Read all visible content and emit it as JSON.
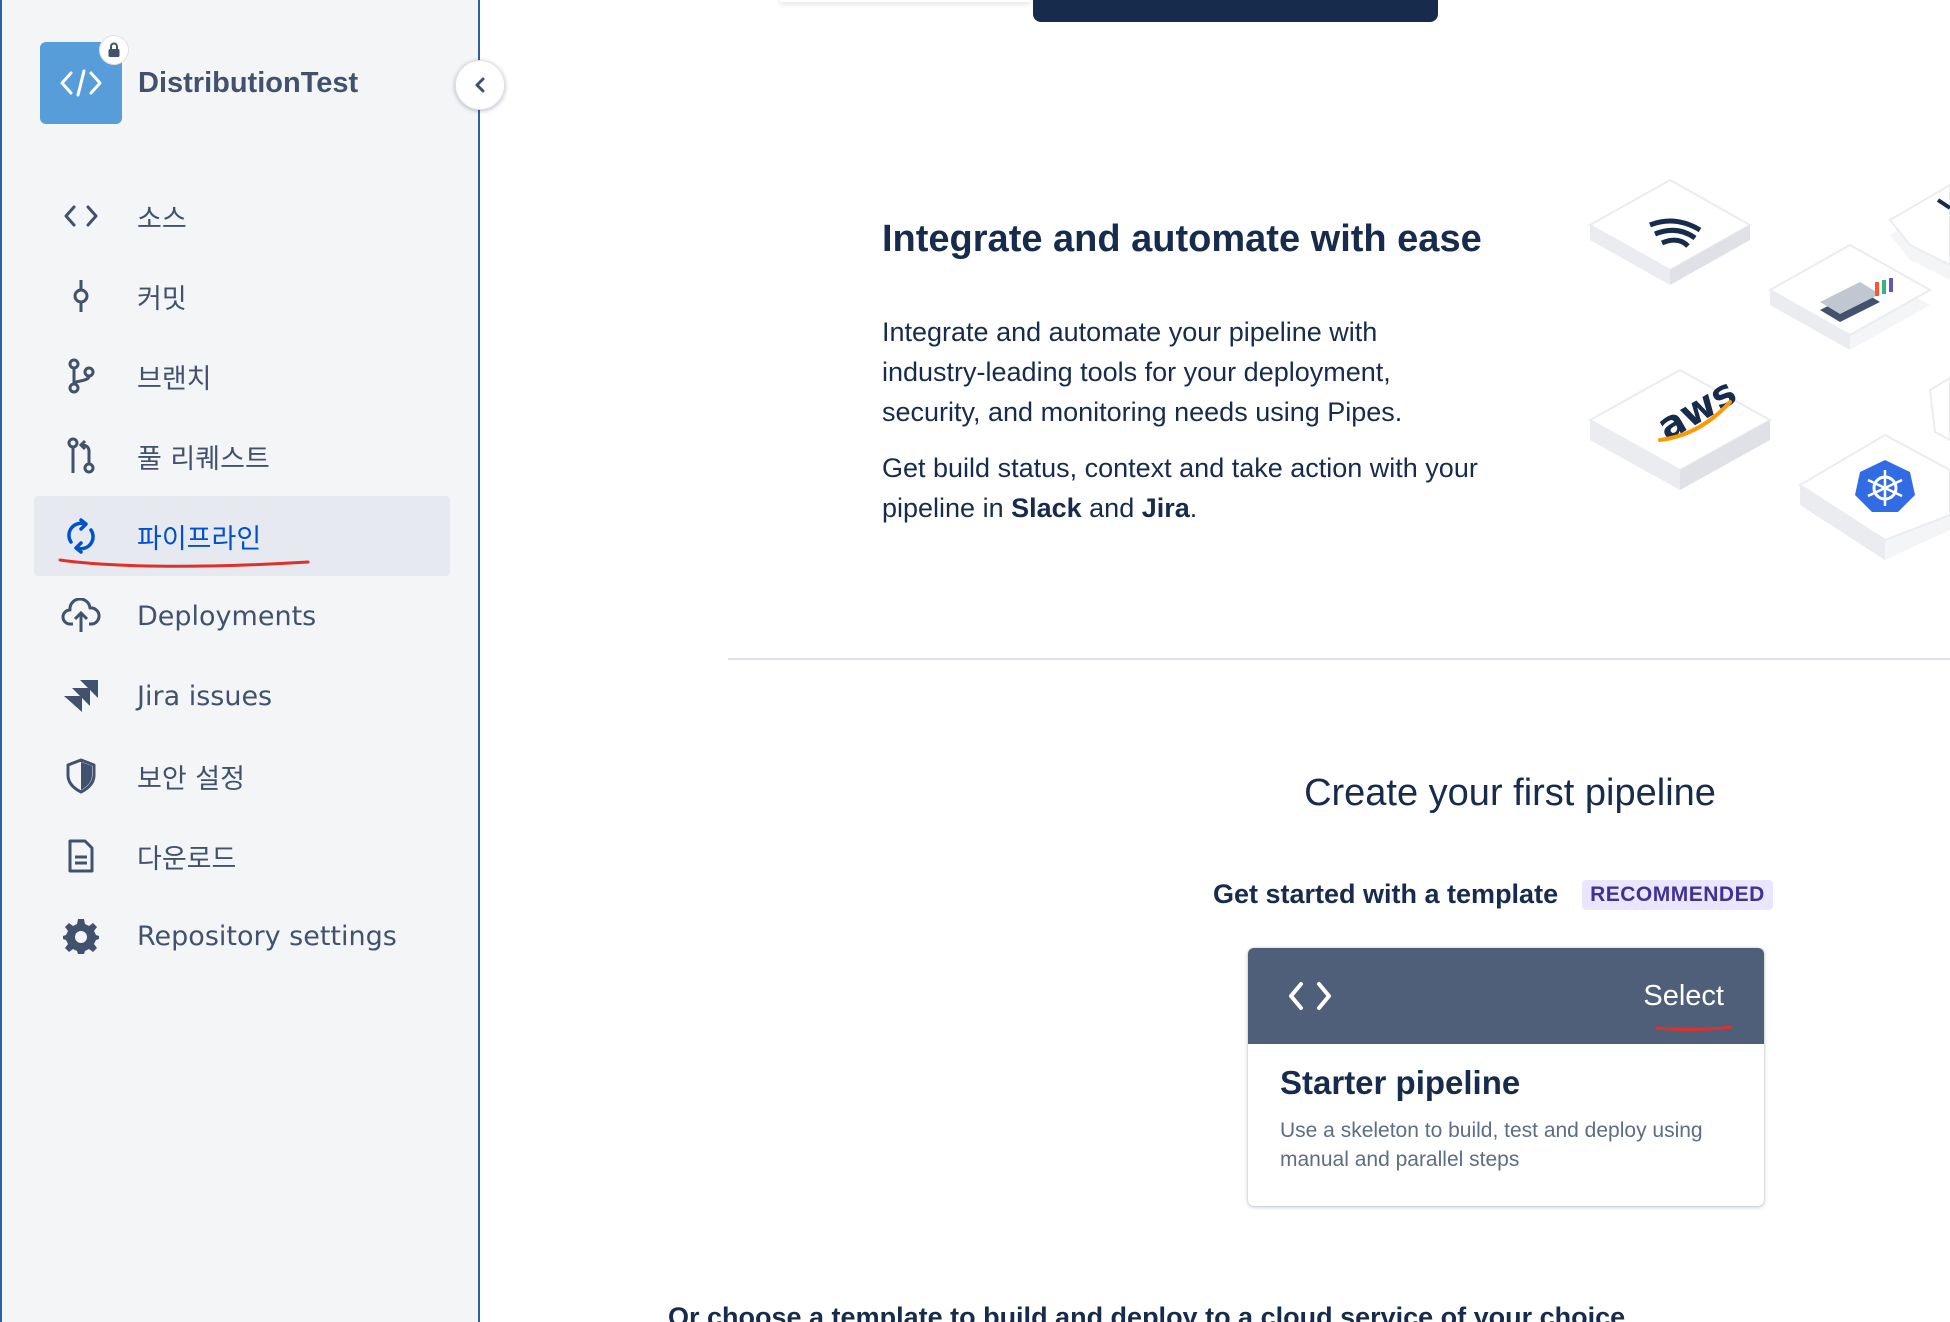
{
  "repo": {
    "name": "DistributionTest"
  },
  "nav": {
    "items": [
      {
        "label": "소스",
        "icon": "code-icon"
      },
      {
        "label": "커밋",
        "icon": "commit-icon"
      },
      {
        "label": "브랜치",
        "icon": "branch-icon"
      },
      {
        "label": "풀 리퀘스트",
        "icon": "pull-request-icon"
      },
      {
        "label": "파이프라인",
        "icon": "pipeline-icon",
        "active": true
      },
      {
        "label": "Deployments",
        "icon": "cloud-upload-icon"
      },
      {
        "label": "Jira issues",
        "icon": "jira-icon"
      },
      {
        "label": "보안 설정",
        "icon": "shield-icon"
      },
      {
        "label": "다운로드",
        "icon": "document-icon"
      },
      {
        "label": "Repository settings",
        "icon": "gear-icon"
      }
    ]
  },
  "integrate": {
    "title": "Integrate and automate with ease",
    "para1": "Integrate and automate your pipeline with industry-leading tools for your deployment, security, and monitoring needs using Pipes.",
    "para2_prefix": "Get build status, context and take action with your pipeline in ",
    "para2_slack": "Slack",
    "para2_and": " and ",
    "para2_jira": "Jira",
    "para2_suffix": "."
  },
  "illustration": {
    "aws_label": "aws"
  },
  "create": {
    "title": "Create your first pipeline",
    "template_label": "Get started with a template",
    "badge": "RECOMMENDED"
  },
  "card": {
    "select_label": "Select",
    "title": "Starter pipeline",
    "description": "Use a skeleton to build, test and deploy using manual and parallel steps"
  },
  "bottom": {
    "text": "Or choose a template to build and deploy to a cloud service of your choice"
  },
  "colors": {
    "accent": "#0052cc",
    "sidebar_bg": "#f4f5f7",
    "card_header": "#505f79",
    "badge_bg": "#eae6ff",
    "annotation_red": "#e0302a"
  }
}
